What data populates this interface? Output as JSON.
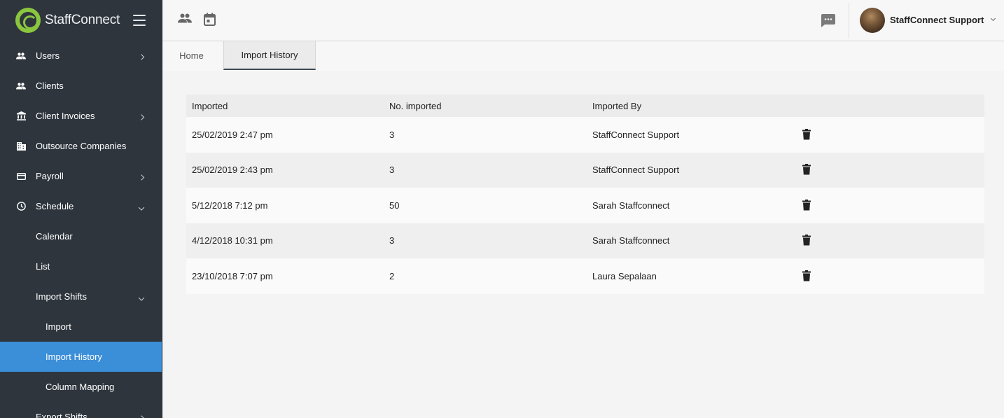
{
  "brand": {
    "name": "StaffConnect",
    "accent": "#8bc63f"
  },
  "sidebar": {
    "items": [
      {
        "label": "Users",
        "icon": "people-icon"
      },
      {
        "label": "Clients",
        "icon": "people-icon"
      },
      {
        "label": "Client Invoices",
        "icon": "bank-icon"
      },
      {
        "label": "Outsource Companies",
        "icon": "building-icon"
      },
      {
        "label": "Payroll",
        "icon": "card-icon"
      },
      {
        "label": "Schedule",
        "icon": "clock-icon"
      },
      {
        "label": "Calendar"
      },
      {
        "label": "List"
      },
      {
        "label": "Import Shifts"
      },
      {
        "label": "Import"
      },
      {
        "label": "Import History"
      },
      {
        "label": "Column Mapping"
      },
      {
        "label": "Export Shifts"
      }
    ],
    "active_color": "#3b8ed8"
  },
  "header": {
    "user_name": "StaffConnect Support"
  },
  "tabs": [
    {
      "label": "Home"
    },
    {
      "label": "Import History"
    }
  ],
  "table": {
    "headers": [
      "Imported",
      "No. imported",
      "Imported By"
    ],
    "rows": [
      {
        "imported": "25/02/2019 2:47 pm",
        "count": "3",
        "by": "StaffConnect Support"
      },
      {
        "imported": "25/02/2019 2:43 pm",
        "count": "3",
        "by": "StaffConnect Support"
      },
      {
        "imported": "5/12/2018 7:12 pm",
        "count": "50",
        "by": "Sarah Staffconnect"
      },
      {
        "imported": "4/12/2018 10:31 pm",
        "count": "3",
        "by": "Sarah Staffconnect"
      },
      {
        "imported": "23/10/2018 7:07 pm",
        "count": "2",
        "by": "Laura Sepalaan"
      }
    ]
  }
}
